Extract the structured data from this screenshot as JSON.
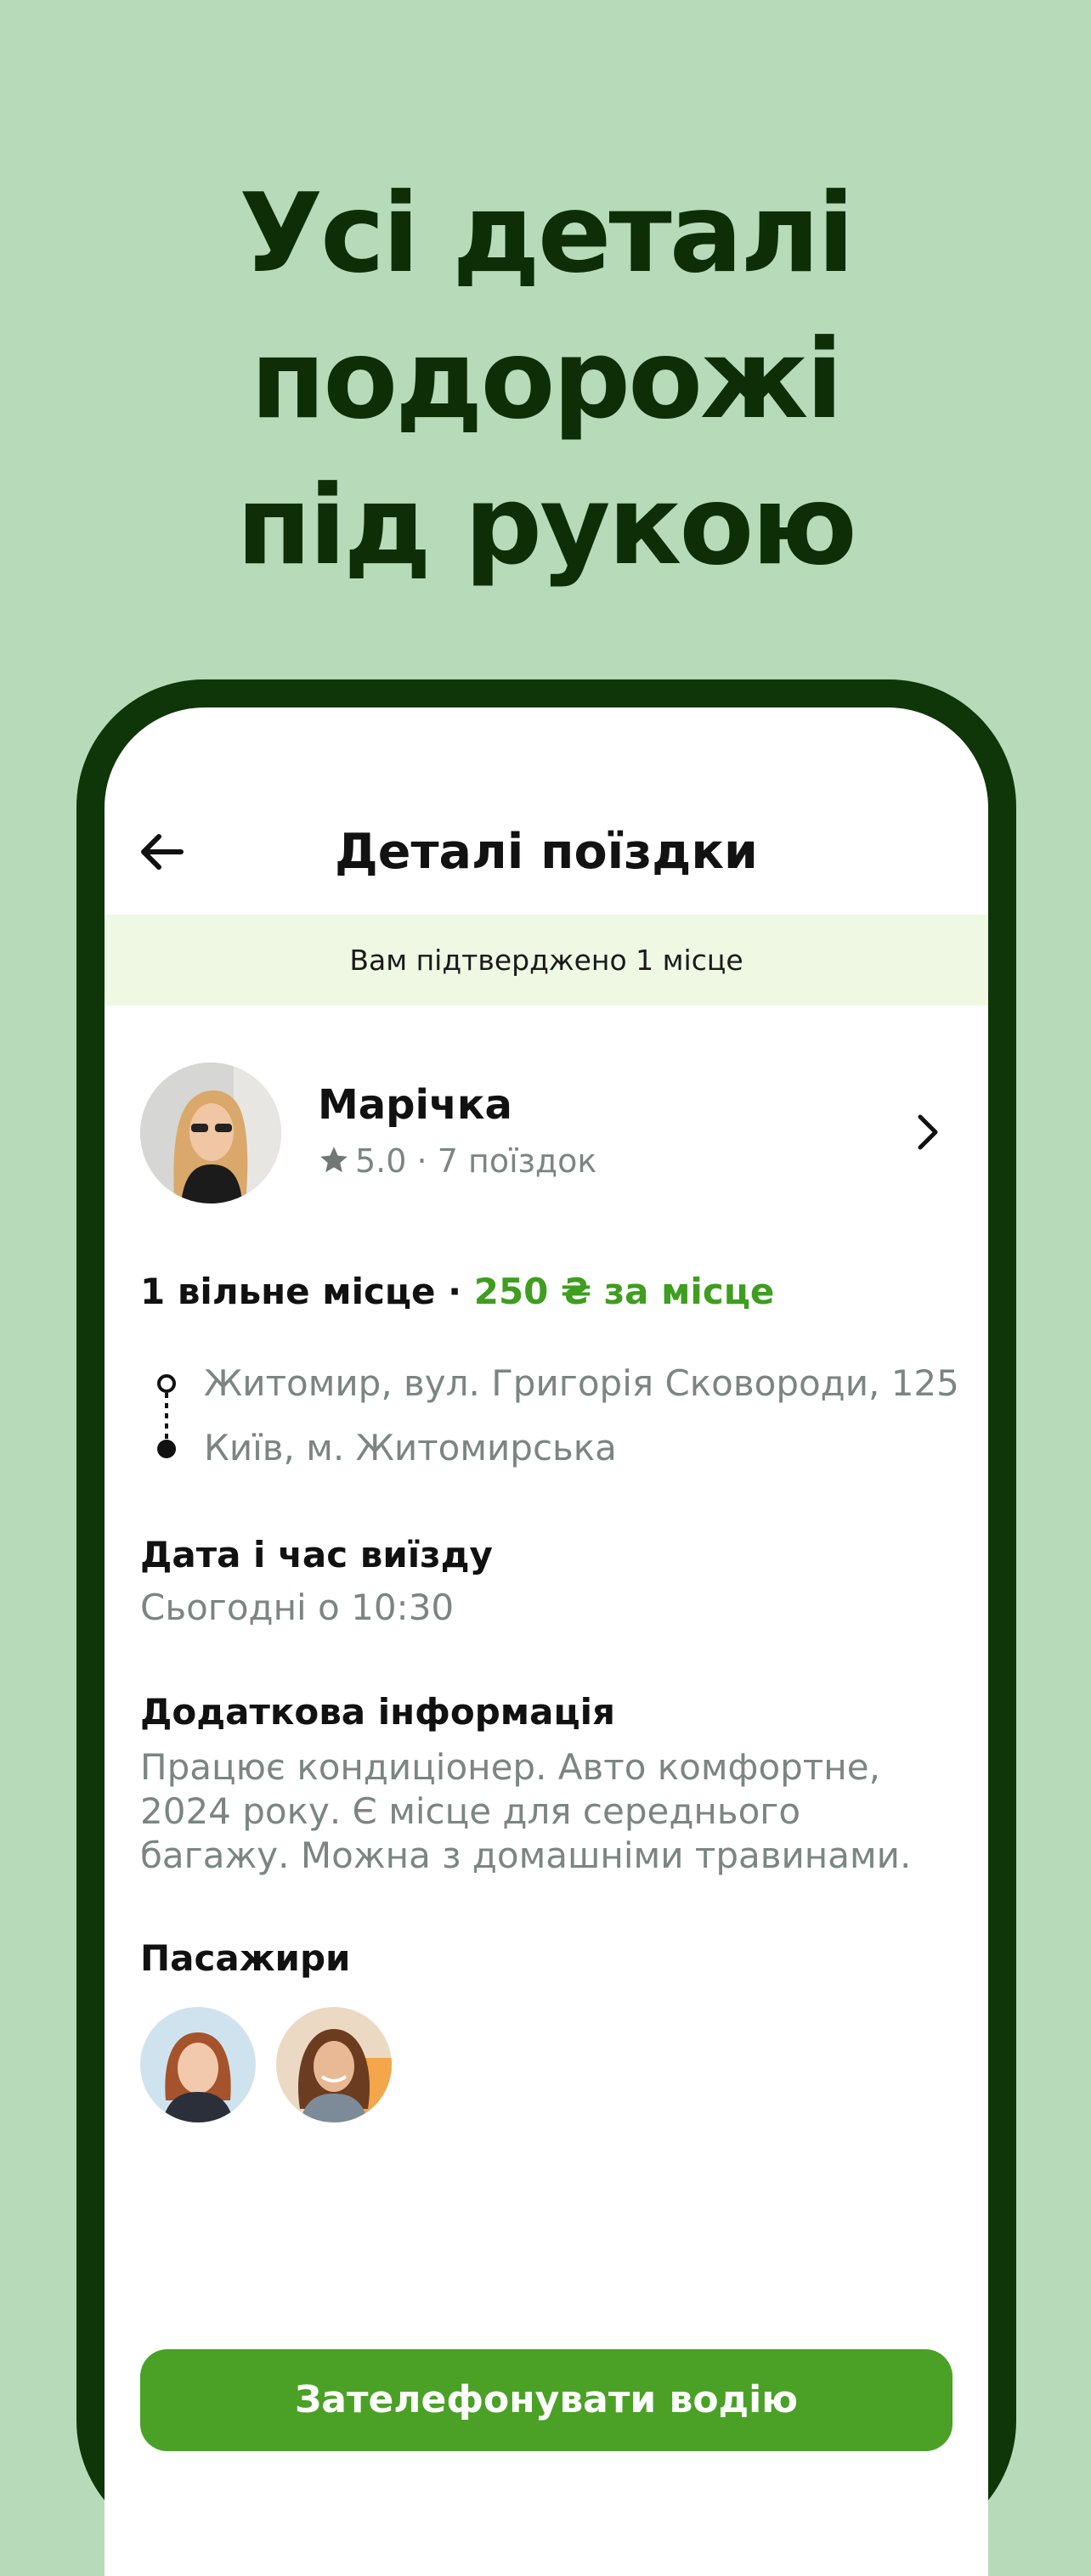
{
  "headline": {
    "line1": "Усі деталі",
    "line2": "подорожі",
    "line3": "під рукою"
  },
  "screen": {
    "title": "Деталі поїздки",
    "banner": "Вам підтверджено 1 місце"
  },
  "driver": {
    "name": "Марічка",
    "rating": "5.0",
    "separator": "·",
    "trips": "7 поїздок"
  },
  "seats": {
    "available": "1 вільне місце",
    "separator": " · ",
    "price": "250 ₴ за місце"
  },
  "route": {
    "from": "Житомир, вул. Григорія Сковороди, 125",
    "to": "Київ, м. Житомирська"
  },
  "departure": {
    "title": "Дата і час виїзду",
    "value": "Сьогодні о 10:30"
  },
  "info": {
    "title": "Додаткова інформація",
    "body": "Працює кондиціонер. Авто комфортне, 2024 року. Є місце для середнього багажу. Можна з домашніми травинами."
  },
  "passengers": {
    "title": "Пасажири"
  },
  "cta": {
    "label": "Зателефонувати водію"
  },
  "colors": {
    "background": "#b7dab8",
    "headline": "#0d2e06",
    "phone_frame": "#0f3608",
    "banner": "#eef8e3",
    "accent": "#3f9d1f",
    "button": "#4aa126",
    "muted": "#7c8582"
  },
  "icons": {
    "back": "arrow-left-icon",
    "star": "star-icon",
    "chevron": "chevron-right-icon"
  }
}
